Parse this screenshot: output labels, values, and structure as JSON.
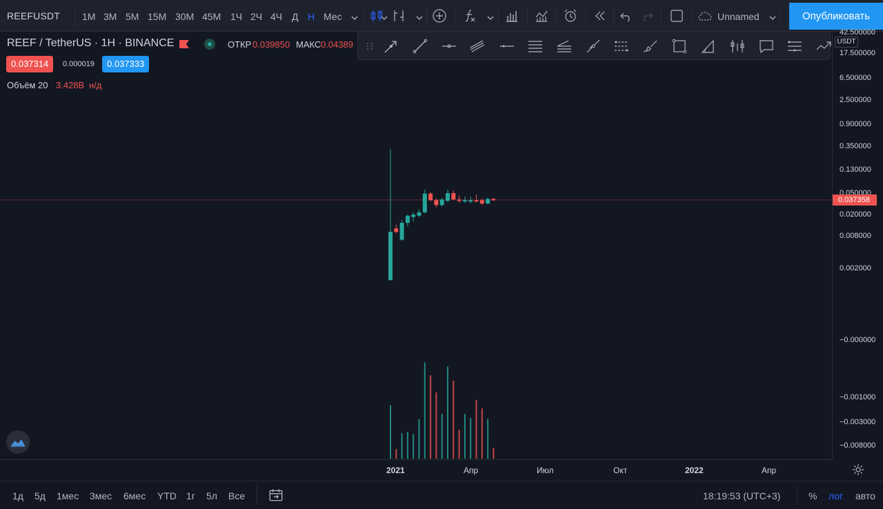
{
  "header": {
    "symbol": "REEFUSDT",
    "intervals": [
      {
        "label": "1М",
        "active": false
      },
      {
        "label": "3М",
        "active": false
      },
      {
        "label": "5М",
        "active": false
      },
      {
        "label": "15М",
        "active": false
      },
      {
        "label": "30М",
        "active": false
      },
      {
        "label": "45М",
        "active": false
      },
      {
        "label": "1Ч",
        "active": false
      },
      {
        "label": "2Ч",
        "active": false
      },
      {
        "label": "4Ч",
        "active": false
      },
      {
        "label": "Д",
        "active": false
      },
      {
        "label": "Н",
        "active": true
      },
      {
        "label": "Мес",
        "active": false
      }
    ],
    "layout_name": "Unnamed",
    "publish_label": "Опубликовать"
  },
  "legend": {
    "title": "REEF / TetherUS · 1H · BINANCE",
    "open_label": "ОТКР",
    "open_value": "0.039850",
    "high_label": "МАКС",
    "high_value": "0.04389",
    "bid": "0.037314",
    "spread": "0.000019",
    "ask": "0.037333",
    "volume_label": "Объём 20",
    "volume_value": "3.428B",
    "volume_na": "н/д"
  },
  "price_axis": {
    "currency": "USDT",
    "last_price": "0.037358",
    "ticks": [
      "42.500000",
      "17.500000",
      "6.500000",
      "2.500000",
      "0.900000",
      "0.350000",
      "0.130000",
      "0.050000",
      "0.020000",
      "0.008000",
      "0.002000",
      "−0.000000",
      "−0.001000",
      "−0.003000",
      "−0.008000"
    ]
  },
  "time_axis": {
    "ticks": [
      "2021",
      "Апр",
      "Июл",
      "Окт",
      "2022",
      "Апр"
    ]
  },
  "bottom": {
    "ranges": [
      "1д",
      "5д",
      "1мес",
      "3мес",
      "6мес",
      "YTD",
      "1г",
      "5л",
      "Все"
    ],
    "clock": "18:19:53 (UTC+3)",
    "percent": "%",
    "log": "лог",
    "auto": "авто"
  },
  "colors": {
    "up": "#26a69a",
    "down": "#ef5350",
    "accent": "#2962ff",
    "publish": "#2196f3"
  },
  "chart_data": {
    "type": "candlestick",
    "scale": "log",
    "candles": [
      {
        "o": 0.0012,
        "h": 0.33,
        "l": 0.0012,
        "c": 0.0095,
        "dir": "up"
      },
      {
        "o": 0.0095,
        "h": 0.013,
        "l": 0.009,
        "c": 0.011,
        "dir": "down"
      },
      {
        "o": 0.0068,
        "h": 0.016,
        "l": 0.0065,
        "c": 0.014,
        "dir": "up"
      },
      {
        "o": 0.014,
        "h": 0.02,
        "l": 0.012,
        "c": 0.019,
        "dir": "up"
      },
      {
        "o": 0.018,
        "h": 0.022,
        "l": 0.015,
        "c": 0.02,
        "dir": "up"
      },
      {
        "o": 0.019,
        "h": 0.025,
        "l": 0.018,
        "c": 0.022,
        "dir": "up"
      },
      {
        "o": 0.022,
        "h": 0.058,
        "l": 0.021,
        "c": 0.049,
        "dir": "up"
      },
      {
        "o": 0.049,
        "h": 0.052,
        "l": 0.035,
        "c": 0.037,
        "dir": "down"
      },
      {
        "o": 0.037,
        "h": 0.04,
        "l": 0.027,
        "c": 0.03,
        "dir": "down"
      },
      {
        "o": 0.03,
        "h": 0.041,
        "l": 0.028,
        "c": 0.038,
        "dir": "up"
      },
      {
        "o": 0.036,
        "h": 0.058,
        "l": 0.034,
        "c": 0.05,
        "dir": "up"
      },
      {
        "o": 0.05,
        "h": 0.056,
        "l": 0.037,
        "c": 0.038,
        "dir": "down"
      },
      {
        "o": 0.038,
        "h": 0.045,
        "l": 0.033,
        "c": 0.036,
        "dir": "down"
      },
      {
        "o": 0.036,
        "h": 0.043,
        "l": 0.033,
        "c": 0.037,
        "dir": "up"
      },
      {
        "o": 0.037,
        "h": 0.043,
        "l": 0.032,
        "c": 0.036,
        "dir": "up"
      },
      {
        "o": 0.036,
        "h": 0.047,
        "l": 0.034,
        "c": 0.037,
        "dir": "down"
      },
      {
        "o": 0.037,
        "h": 0.04,
        "l": 0.03,
        "c": 0.032,
        "dir": "down"
      },
      {
        "o": 0.032,
        "h": 0.042,
        "l": 0.031,
        "c": 0.039,
        "dir": "up"
      },
      {
        "o": 0.039,
        "h": 0.041,
        "l": 0.036,
        "c": 0.037,
        "dir": "down"
      }
    ],
    "volume": [
      {
        "v": 0.5,
        "dir": "up"
      },
      {
        "v": 0.09,
        "dir": "down"
      },
      {
        "v": 0.24,
        "dir": "up"
      },
      {
        "v": 0.25,
        "dir": "up"
      },
      {
        "v": 0.23,
        "dir": "up"
      },
      {
        "v": 0.37,
        "dir": "up"
      },
      {
        "v": 0.9,
        "dir": "up"
      },
      {
        "v": 0.78,
        "dir": "down"
      },
      {
        "v": 0.62,
        "dir": "down"
      },
      {
        "v": 0.42,
        "dir": "up"
      },
      {
        "v": 0.86,
        "dir": "up"
      },
      {
        "v": 0.73,
        "dir": "down"
      },
      {
        "v": 0.27,
        "dir": "down"
      },
      {
        "v": 0.42,
        "dir": "up"
      },
      {
        "v": 0.38,
        "dir": "up"
      },
      {
        "v": 0.55,
        "dir": "down"
      },
      {
        "v": 0.47,
        "dir": "down"
      },
      {
        "v": 0.37,
        "dir": "up"
      },
      {
        "v": 0.1,
        "dir": "down"
      }
    ],
    "ylim": [
      0.001,
      50
    ]
  }
}
